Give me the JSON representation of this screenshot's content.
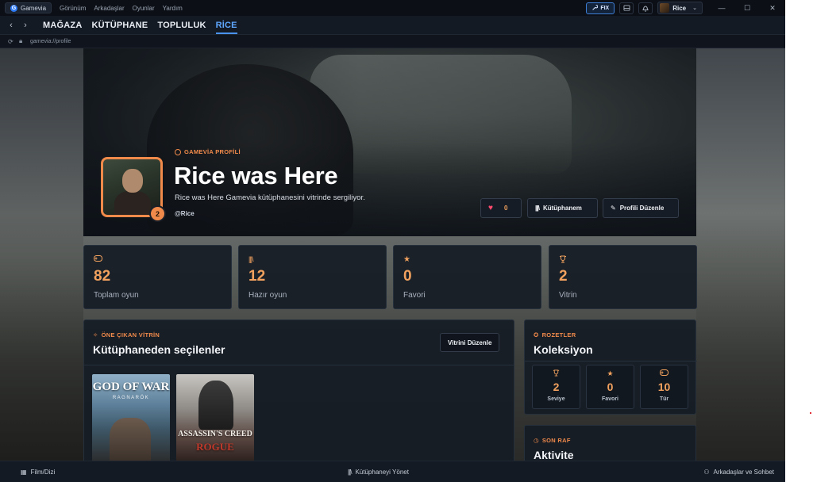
{
  "titlebar": {
    "app_name": "Gamevia",
    "menu": [
      "Görünüm",
      "Arkadaşlar",
      "Oyunlar",
      "Yardım"
    ],
    "fix_label": "FIX",
    "user_name": "Rice",
    "icons": [
      "archive-icon",
      "bell-icon"
    ]
  },
  "navbar": {
    "tabs": [
      {
        "label": "MAĞAZA",
        "active": false
      },
      {
        "label": "KÜTÜPHANE",
        "active": false
      },
      {
        "label": "TOPLULUK",
        "active": false
      },
      {
        "label": "RİCE",
        "active": true
      }
    ]
  },
  "address": {
    "url": "gamevia://profile"
  },
  "profile": {
    "tag": "GAMEVİA PROFİLİ",
    "name": "Rice was Here",
    "description": "Rice was Here Gamevia kütüphanesini vitrinde sergiliyor.",
    "handle": "@Rice",
    "level": "2",
    "likes": "0",
    "library_button": "Kütüphanem",
    "edit_button": "Profili Düzenle"
  },
  "stats": [
    {
      "icon": "gamepad-icon",
      "value": "82",
      "label": "Toplam oyun"
    },
    {
      "icon": "library-icon",
      "value": "12",
      "label": "Hazır oyun"
    },
    {
      "icon": "star-icon",
      "value": "0",
      "label": "Favori"
    },
    {
      "icon": "trophy-icon",
      "value": "2",
      "label": "Vitrin"
    }
  ],
  "showcase": {
    "tag": "ÖNE ÇIKAN VİTRİN",
    "title": "Kütüphaneden seçilenler",
    "edit_button": "Vitrini Düzenle",
    "games": [
      {
        "title": "GOD OF WAR",
        "subtitle": "RAGNARÖK"
      },
      {
        "title": "ASSASSIN'S CREED",
        "subtitle": "ROGUE"
      }
    ]
  },
  "badges": {
    "tag": "ROZETLER",
    "title": "Koleksiyon",
    "items": [
      {
        "icon": "trophy-icon",
        "value": "2",
        "label": "Seviye"
      },
      {
        "icon": "star-icon",
        "value": "0",
        "label": "Favori"
      },
      {
        "icon": "gamepad-icon",
        "value": "10",
        "label": "Tür"
      }
    ]
  },
  "activity": {
    "tag": "SON RAF",
    "title": "Aktivite"
  },
  "bottombar": {
    "film": "Film/Dizi",
    "manage": "Kütüphaneyi Yönet",
    "friends": "Arkadaşlar ve Sohbet"
  },
  "colors": {
    "accent": "#f2a25e",
    "tag_orange": "#f08a4b",
    "active_tab": "#5fa8ff",
    "panel": "#161c25",
    "heart": "#ff4b6e"
  }
}
